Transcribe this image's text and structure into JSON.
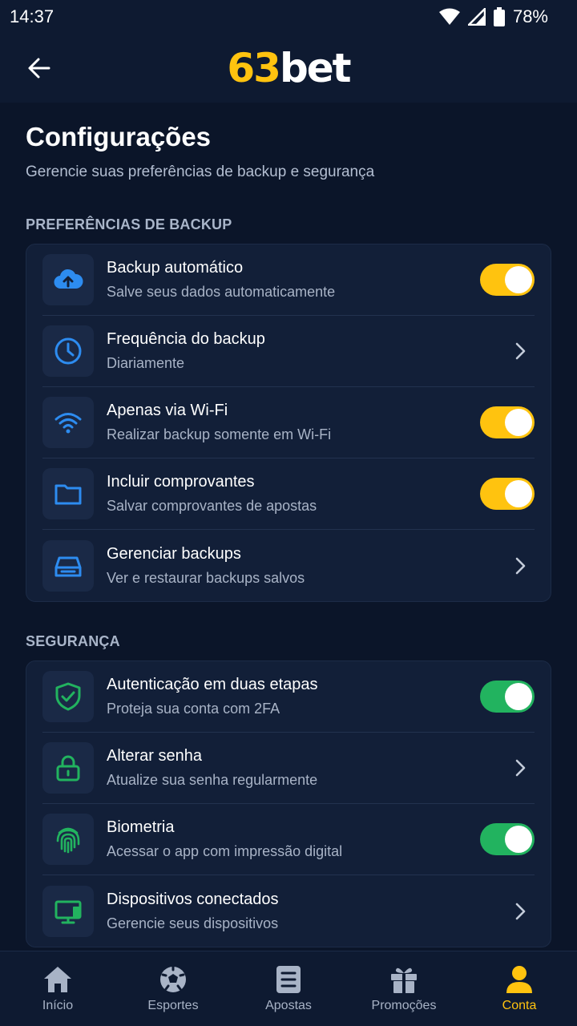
{
  "status": {
    "time": "14:37",
    "battery": "78%"
  },
  "app": {
    "logo_num": "63",
    "logo_text": "bet"
  },
  "page": {
    "title": "Configurações",
    "subtitle": "Gerencie suas preferências de backup e segurança"
  },
  "backup": {
    "label": "PREFERÊNCIAS DE BACKUP",
    "items": [
      {
        "title": "Backup automático",
        "subtitle": "Salve seus dados automaticamente",
        "control": "toggle",
        "on": true
      },
      {
        "title": "Frequência do backup",
        "subtitle": "Diariamente",
        "control": "chevron"
      },
      {
        "title": "Apenas via Wi-Fi",
        "subtitle": "Realizar backup somente em Wi-Fi",
        "control": "toggle",
        "on": true
      },
      {
        "title": "Incluir comprovantes",
        "subtitle": "Salvar comprovantes de apostas",
        "control": "toggle",
        "on": true
      },
      {
        "title": "Gerenciar backups",
        "subtitle": "Ver e restaurar backups salvos",
        "control": "chevron"
      }
    ]
  },
  "security": {
    "label": "SEGURANÇA",
    "items": [
      {
        "title": "Autenticação em duas etapas",
        "subtitle": "Proteja sua conta com 2FA",
        "control": "toggle",
        "on": true
      },
      {
        "title": "Alterar senha",
        "subtitle": "Atualize sua senha regularmente",
        "control": "chevron"
      },
      {
        "title": "Biometria",
        "subtitle": "Acessar o app com impressão digital",
        "control": "toggle",
        "on": true
      },
      {
        "title": "Dispositivos conectados",
        "subtitle": "Gerencie seus dispositivos",
        "control": "chevron"
      }
    ]
  },
  "nav": {
    "items": [
      {
        "label": "Início",
        "icon": "home-icon"
      },
      {
        "label": "Esportes",
        "icon": "soccer-ball-icon"
      },
      {
        "label": "Apostas",
        "icon": "bet-slip-icon"
      },
      {
        "label": "Promoções",
        "icon": "gift-icon"
      },
      {
        "label": "Conta",
        "icon": "user-icon",
        "active": true
      }
    ]
  },
  "colors": {
    "accent": "#ffc30f",
    "security_accent": "#22b35f",
    "backup_icon": "#2d8cf0",
    "background": "#0b1529",
    "card": "#121f38"
  }
}
